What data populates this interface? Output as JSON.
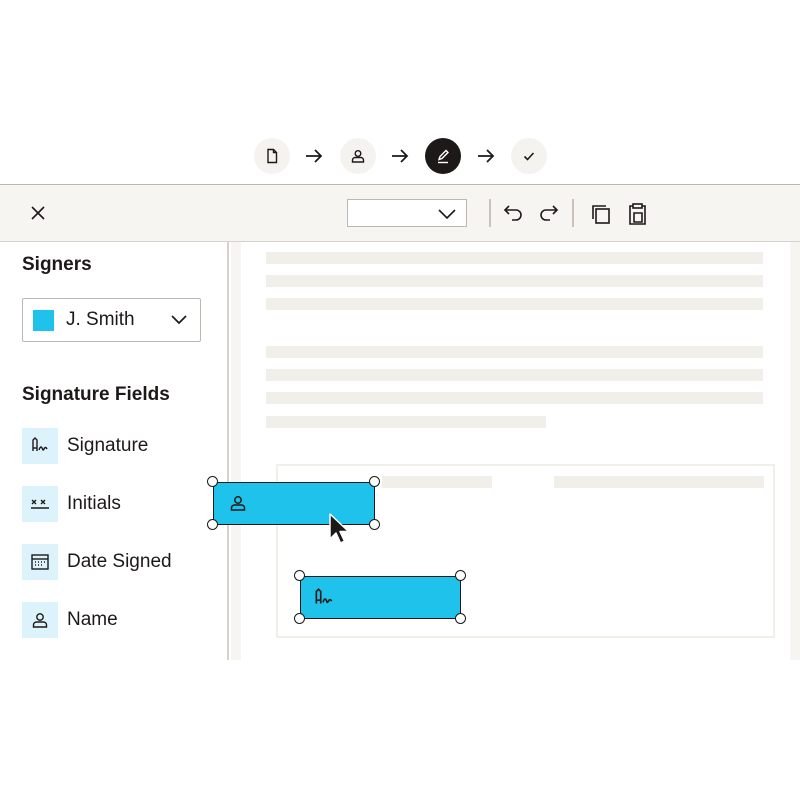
{
  "stepper": {
    "steps": [
      {
        "icon": "document-icon",
        "state": "done"
      },
      {
        "icon": "person-icon",
        "state": "done"
      },
      {
        "icon": "pen-icon",
        "state": "active"
      },
      {
        "icon": "checkmark-icon",
        "state": "pending"
      }
    ]
  },
  "toolbar": {
    "page_select_value": "",
    "icons": [
      "close-icon",
      "chevron-down-icon",
      "undo-icon",
      "redo-icon",
      "copy-icon",
      "paste-icon"
    ]
  },
  "sidebar": {
    "signers_heading": "Signers",
    "signer": {
      "name": "J. Smith",
      "color": "#1fc2ea"
    },
    "fields_heading": "Signature Fields",
    "fields": [
      {
        "label": "Signature",
        "icon": "signature-icon"
      },
      {
        "label": "Initials",
        "icon": "initials-icon"
      },
      {
        "label": "Date Signed",
        "icon": "calendar-icon"
      },
      {
        "label": "Name",
        "icon": "person-icon"
      }
    ]
  },
  "document": {
    "placed_fields": [
      {
        "type": "Name",
        "icon": "person-icon",
        "signer_color": "#1fc2ea",
        "selected": true
      },
      {
        "type": "Signature",
        "icon": "signature-icon",
        "signer_color": "#1fc2ea",
        "selected": true
      }
    ]
  },
  "colors": {
    "accent": "#1fc2ea",
    "field_icon_bg": "#dcf3fb",
    "text": "#1e1919",
    "toolbar_bg": "#f7f5f2",
    "placeholder_line": "#f1efea"
  }
}
